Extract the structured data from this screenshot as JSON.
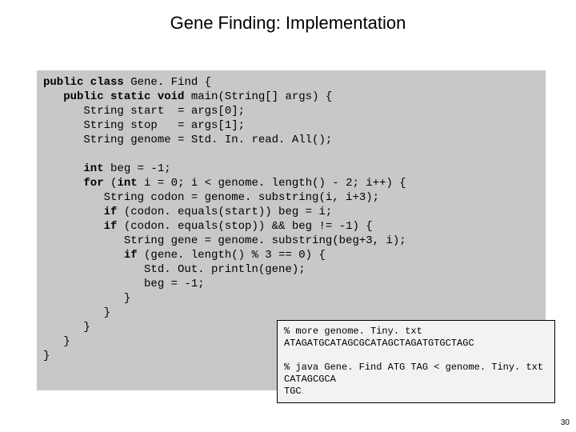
{
  "title": "Gene Finding:  Implementation",
  "code": {
    "l1a": "public class",
    "l1b": " Gene. Find {",
    "l2a": "   public static void",
    "l2b": " main(String[] args) {",
    "l3": "      String start  = args[0];",
    "l4": "      String stop   = args[1];",
    "l5": "      String genome = Std. In. read. All();",
    "l6": "",
    "l7a": "      int",
    "l7b": " beg = -1;",
    "l8a": "      for",
    "l8b": " (",
    "l8c": "int",
    "l8d": " i = 0; i < genome. length() - 2; i++) {",
    "l9": "         String codon = genome. substring(i, i+3);",
    "l10a": "         if",
    "l10b": " (codon. equals(start)) beg = i;",
    "l11a": "         if",
    "l11b": " (codon. equals(stop)) && beg != -1) {",
    "l12": "            String gene = genome. substring(beg+3, i);",
    "l13a": "            if",
    "l13b": " (gene. length() % 3 == 0) {",
    "l14": "               Std. Out. println(gene);",
    "l15": "               beg = -1;",
    "l16": "            }",
    "l17": "         }",
    "l18": "      }",
    "l19": "   }",
    "l20": "}"
  },
  "output": {
    "l1": "% more genome. Tiny. txt",
    "l2": "ATAGATGCATAGCGCATAGCTAGATGTGCTAGC",
    "l3": "",
    "l4": "% java Gene. Find ATG TAG < genome. Tiny. txt",
    "l5": "CATAGCGCA",
    "l6": "TGC"
  },
  "page_number": "30"
}
